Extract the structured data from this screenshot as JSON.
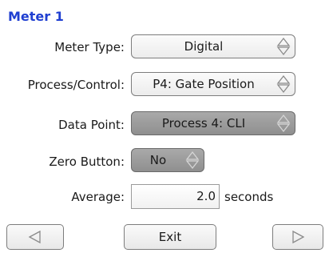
{
  "title": "Meter 1",
  "meter_type": {
    "label": "Meter Type:",
    "value": "Digital"
  },
  "process_control": {
    "label": "Process/Control:",
    "value": "P4: Gate Position"
  },
  "data_point": {
    "label": "Data Point:",
    "value": "Process 4: CLI"
  },
  "zero_button": {
    "label": "Zero Button:",
    "value": "No"
  },
  "average": {
    "label": "Average:",
    "value": "2.0",
    "units": "seconds"
  },
  "buttons": {
    "exit": "Exit"
  },
  "icons": [
    "updown-spinner-icon",
    "left-arrow-icon",
    "right-arrow-icon"
  ],
  "colors": {
    "title": "#1f3fd1",
    "selected_field": "#9b9b9b"
  }
}
